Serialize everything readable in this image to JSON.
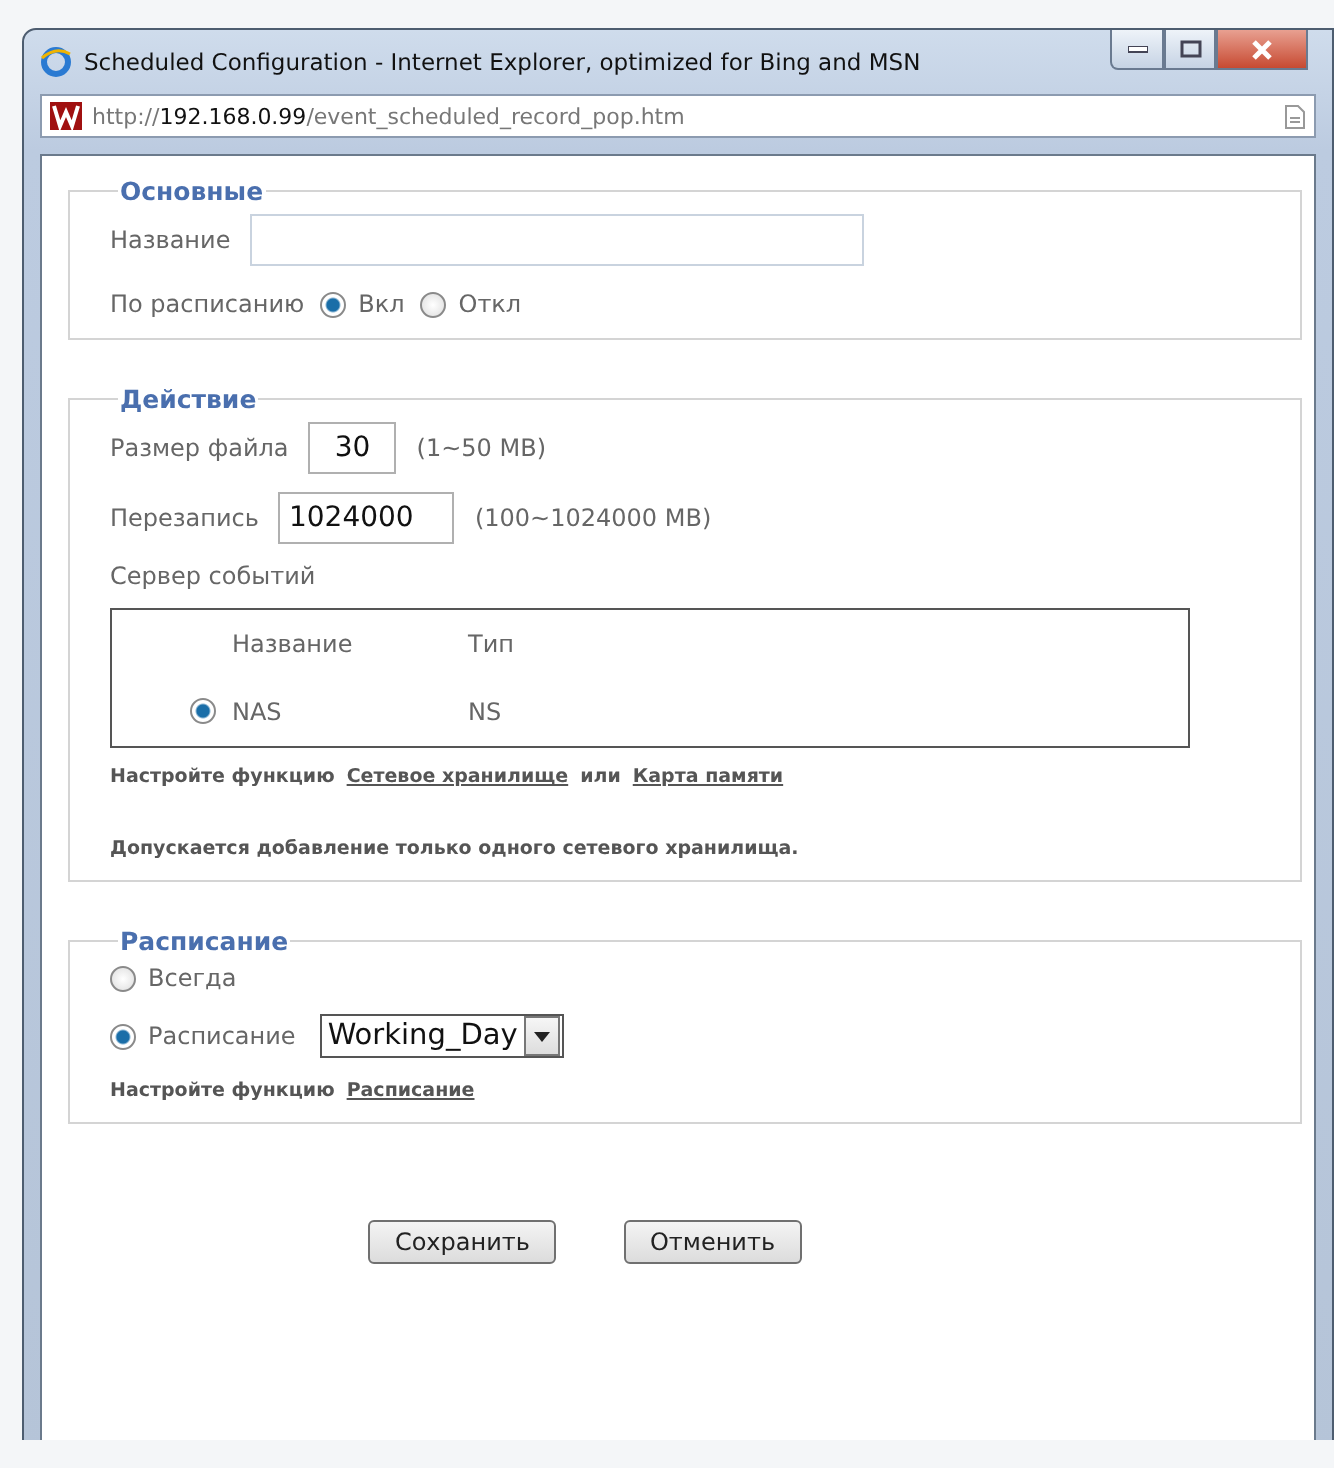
{
  "window": {
    "title": "Scheduled Configuration - Internet Explorer, optimized for Bing and MSN",
    "url": {
      "scheme": "http://",
      "host": "192.168.0.99",
      "path": "/event_scheduled_record_pop.htm"
    }
  },
  "basic": {
    "legend": "Основные",
    "name_label": "Название",
    "schedule_label": "По расписанию",
    "options": [
      {
        "label": "Вкл",
        "selected": true
      },
      {
        "label": "Откл",
        "selected": false
      }
    ]
  },
  "action": {
    "legend": "Действие",
    "fields": [
      {
        "label": "Размер файла",
        "value": "30",
        "hint": "(1~50 MB)",
        "kind": "short"
      },
      {
        "label": "Перезапись",
        "value": "1024000",
        "hint": "(100~1024000 MB)",
        "kind": "long"
      }
    ],
    "server_label": "Сервер событий",
    "columns": [
      "Название",
      "Тип"
    ],
    "rows": [
      {
        "name": "NAS",
        "type": "NS",
        "selected": true
      }
    ],
    "configure": {
      "text": "Настройте функцию",
      "links": [
        "Сетевое хранилище",
        "Карта памяти"
      ],
      "joiner": "или"
    },
    "notice": "Допускается добавление только одного сетевого хранилища."
  },
  "schedule": {
    "legend": "Расписание",
    "options": [
      {
        "label": "Всегда",
        "selected": false
      },
      {
        "label": "Расписание",
        "selected": true
      }
    ],
    "select_value": "Working_Day",
    "configure": {
      "text": "Настройте функцию",
      "link": "Расписание"
    }
  },
  "buttons": [
    "Сохранить",
    "Отменить"
  ]
}
